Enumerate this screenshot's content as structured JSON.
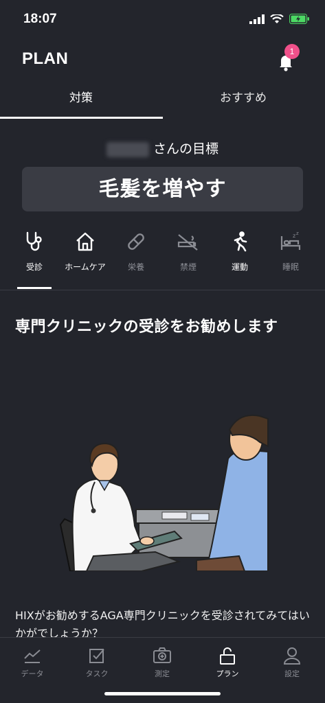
{
  "status_bar": {
    "time": "18:07"
  },
  "header": {
    "title": "PLAN",
    "notification_count": "1"
  },
  "tabs": [
    {
      "label": "対策"
    },
    {
      "label": "おすすめ"
    }
  ],
  "goal": {
    "owner_suffix": "さんの目標",
    "title": "毛髪を増やす"
  },
  "categories": [
    {
      "label": "受診",
      "icon": "stethoscope-icon",
      "active": true
    },
    {
      "label": "ホームケア",
      "icon": "home-icon"
    },
    {
      "label": "栄養",
      "icon": "pill-icon"
    },
    {
      "label": "禁煙",
      "icon": "no-smoking-icon"
    },
    {
      "label": "運動",
      "icon": "running-icon"
    },
    {
      "label": "睡眠",
      "icon": "sleep-icon"
    }
  ],
  "content": {
    "title": "専門クリニックの受診をお勧めします",
    "body": "HIXがお勧めするAGA専門クリニックを受診されてみてはいかがでしょうか？"
  },
  "bottom_nav": [
    {
      "label": "データ",
      "icon": "chart-icon"
    },
    {
      "label": "タスク",
      "icon": "checkbox-icon"
    },
    {
      "label": "測定",
      "icon": "camera-icon"
    },
    {
      "label": "プラン",
      "icon": "unlock-icon",
      "active": true
    },
    {
      "label": "設定",
      "icon": "person-icon"
    }
  ],
  "colors": {
    "background": "#23252c",
    "badge": "#f0508a",
    "battery": "#4cd964"
  }
}
